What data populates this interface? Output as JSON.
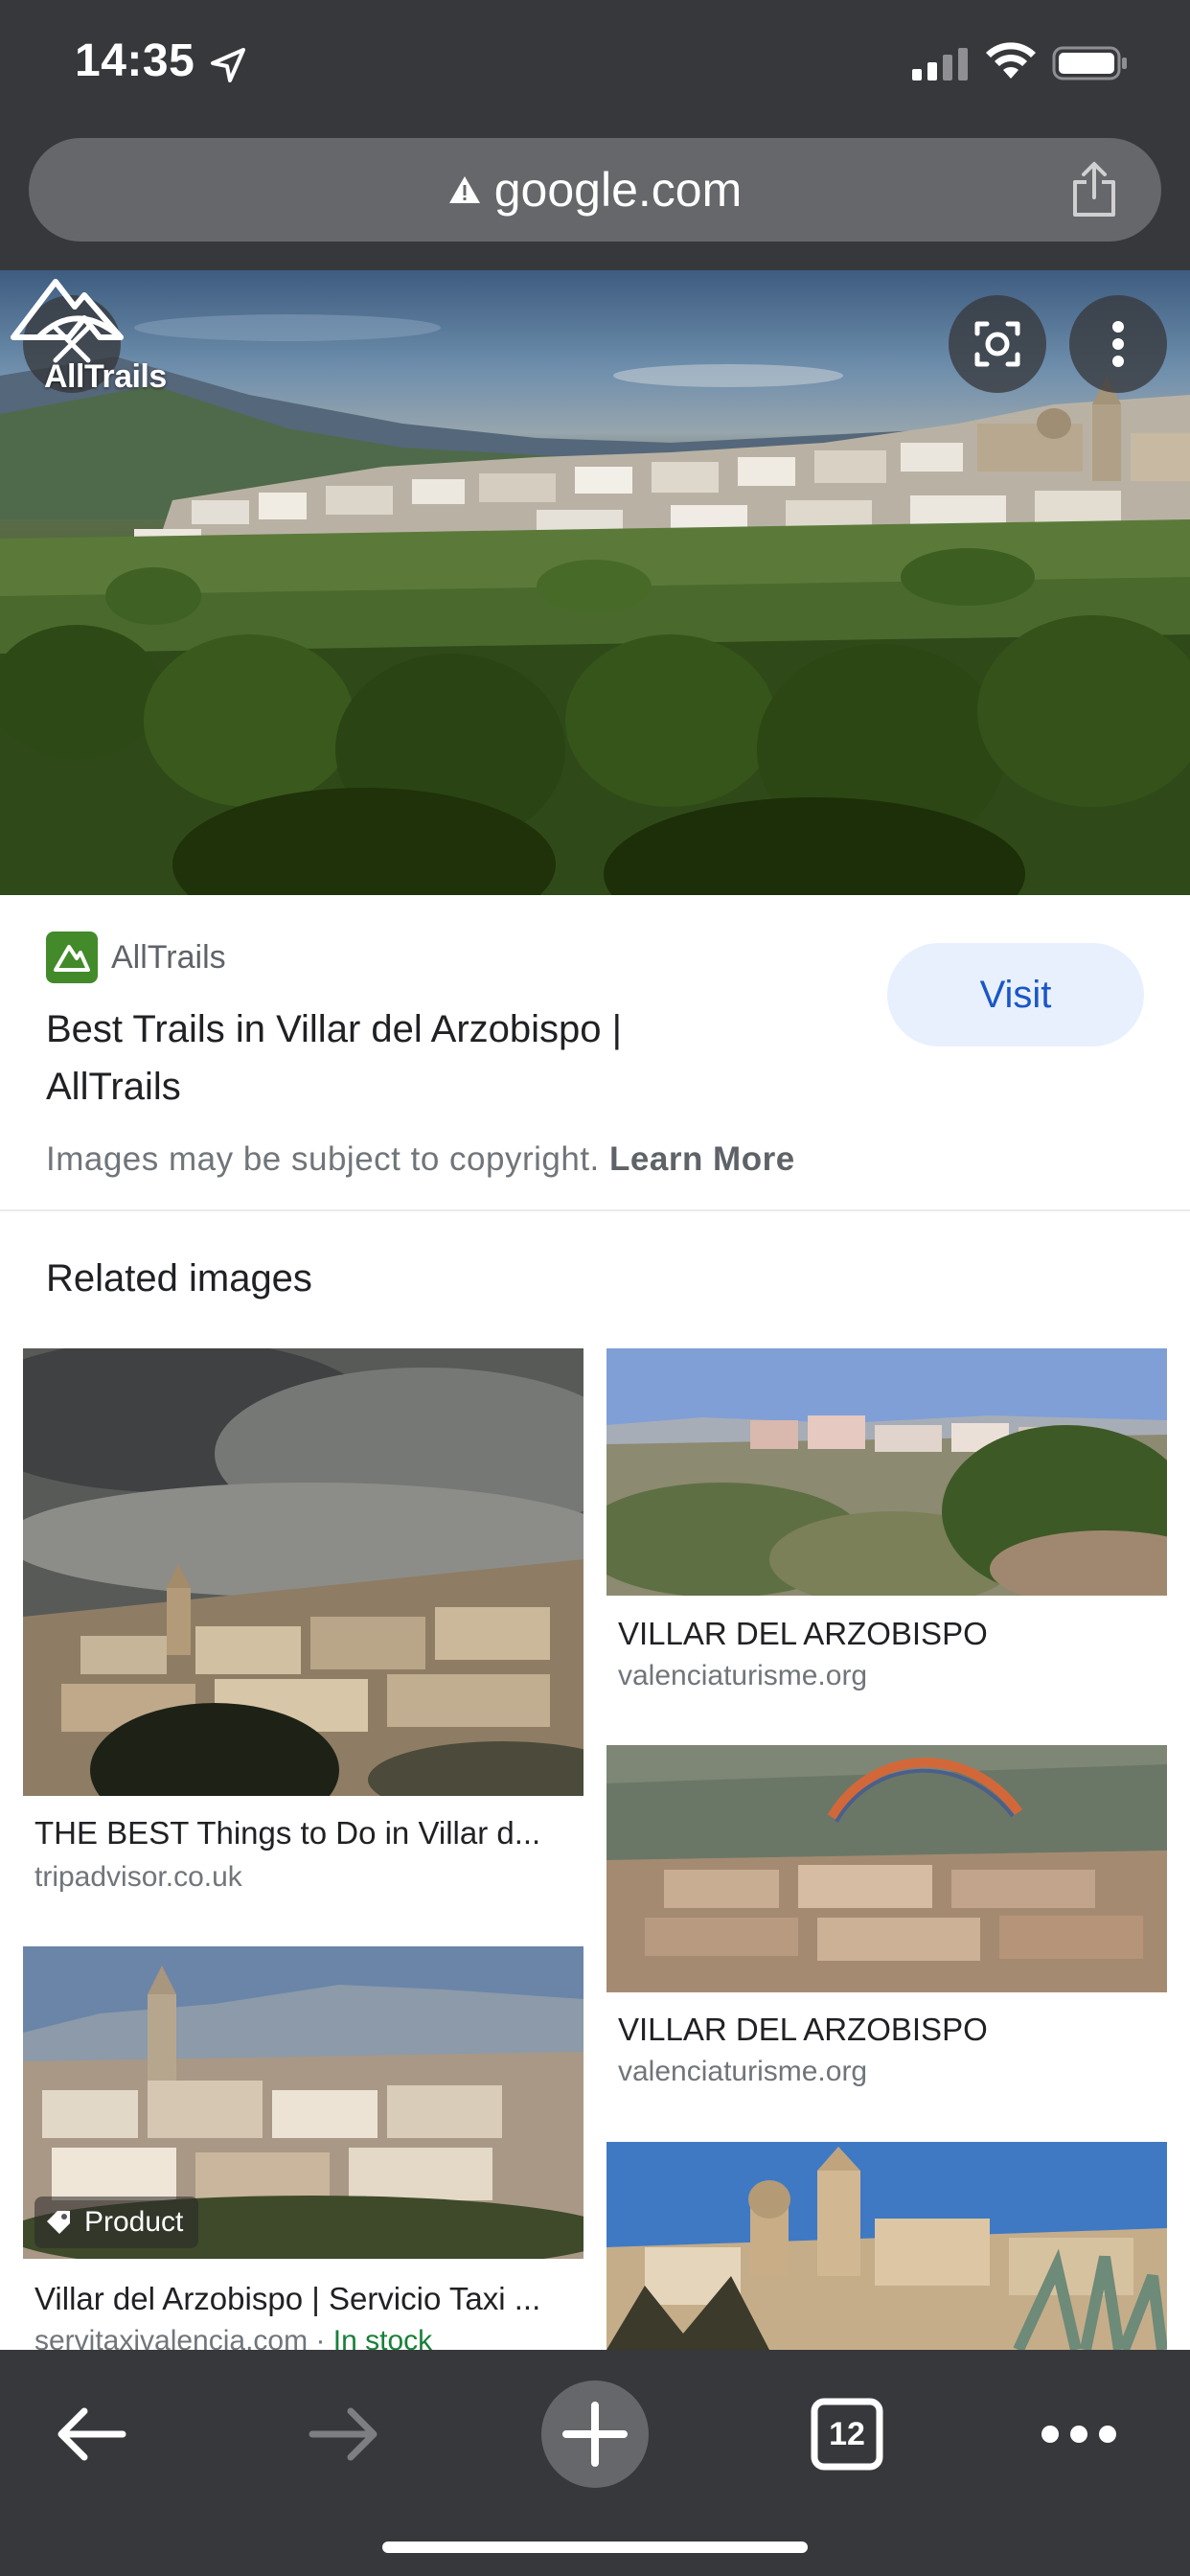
{
  "status_bar": {
    "time": "14:35",
    "icons": [
      "location-arrow-icon",
      "cellular-signal-icon",
      "wifi-icon",
      "battery-icon"
    ]
  },
  "address_bar": {
    "url": "google.com",
    "security_icon": "warning-triangle-icon",
    "share_icon": "share-icon"
  },
  "hero": {
    "logo_text": "AllTrails",
    "buttons": [
      "close-icon",
      "lens-icon",
      "more-vert-icon"
    ]
  },
  "source": {
    "site_name": "AllTrails",
    "title": "Best Trails in Villar del Arzobispo | AllTrails",
    "visit_label": "Visit",
    "copyright_text": "Images may be subject to copyright.",
    "learn_more": "Learn More"
  },
  "related": {
    "heading": "Related images",
    "items": [
      {
        "title": "THE BEST Things to Do in Villar d...",
        "source": "tripadvisor.co.uk"
      },
      {
        "title": "VILLAR DEL ARZOBISPO",
        "source": "valenciaturisme.org"
      },
      {
        "title": "VILLAR DEL ARZOBISPO",
        "source": "valenciaturisme.org"
      },
      {
        "badge": "Product",
        "title": "Villar del Arzobispo | Servicio Taxi ...",
        "source": "servitaxivalencia.com",
        "separator": " · ",
        "stock": "In stock"
      }
    ]
  },
  "toolbar": {
    "tab_count": "12",
    "buttons": [
      "back-arrow-icon",
      "forward-arrow-icon",
      "new-tab-plus-icon",
      "tabs-icon",
      "more-horiz-icon"
    ]
  },
  "colors": {
    "chrome": "#37383c",
    "url_bar": "#66676b",
    "visit_bg": "#e8f0fe",
    "visit_text": "#1a56c8",
    "stock_green": "#188038",
    "favicon_green": "#428a2a"
  }
}
